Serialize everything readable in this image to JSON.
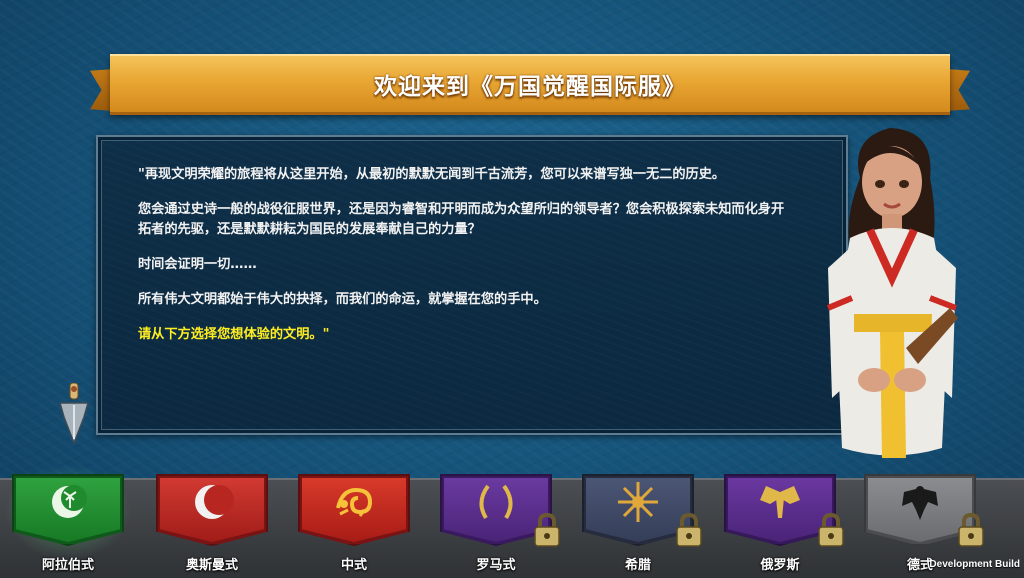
{
  "banner": {
    "title": "欢迎来到《万国觉醒国际服》"
  },
  "dialogue": {
    "paragraphs": [
      "\"再现文明荣耀的旅程将从这里开始，从最初的默默无闻到千古流芳，您可以来谱写独一无二的历史。",
      "您会通过史诗一般的战役征服世界，还是因为睿智和开明而成为众望所归的领导者？您会积极探索未知而化身开拓者的先驱，还是默默耕耘为国民的发展奉献自己的力量？",
      "时间会证明一切……",
      "所有伟大文明都始于伟大的抉择，而我们的命运，就掌握在您的手中。"
    ],
    "prompt": "请从下方选择您想体验的文明。\"",
    "prompt_color": "#ffee22"
  },
  "civilizations": [
    {
      "label": "阿拉伯式",
      "color": "#1f8a2e",
      "emblem": "crescent-palm-icon",
      "locked": false,
      "selected": true
    },
    {
      "label": "奥斯曼式",
      "color": "#b32222",
      "emblem": "crescent-icon",
      "locked": false,
      "selected": false
    },
    {
      "label": "中式",
      "color": "#c42420",
      "emblem": "dragon-icon",
      "locked": false,
      "selected": false
    },
    {
      "label": "罗马式",
      "color": "#5b2e8c",
      "emblem": "laurel-wreath-icon",
      "locked": true,
      "selected": false
    },
    {
      "label": "希腊",
      "color": "#3f4a66",
      "emblem": "vergina-sun-icon",
      "locked": true,
      "selected": false
    },
    {
      "label": "俄罗斯",
      "color": "#5a2d8a",
      "emblem": "double-eagle-icon",
      "locked": true,
      "selected": false
    },
    {
      "label": "德式",
      "color": "#6e7073",
      "emblem": "eagle-icon",
      "locked": true,
      "selected": false
    }
  ],
  "footer": {
    "build_label": "Development Build"
  }
}
